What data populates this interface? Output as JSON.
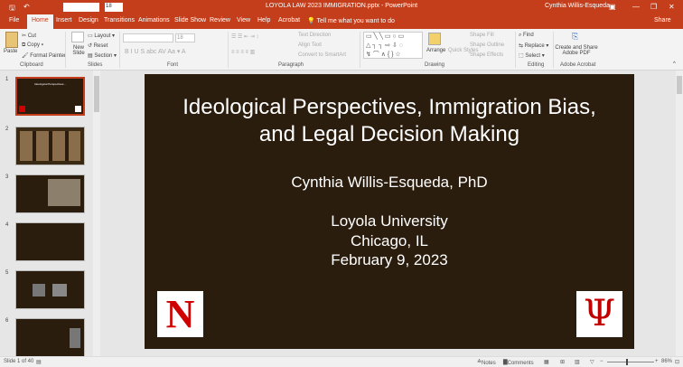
{
  "window": {
    "title": "LOYOLA LAW 2023 IMMIGRATION.pptx  -  PowerPoint",
    "user": "Cynthia Willis-Esqueda",
    "font_size": "18"
  },
  "tabs": [
    "File",
    "Home",
    "Insert",
    "Design",
    "Transitions",
    "Animations",
    "Slide Show",
    "Review",
    "View",
    "Help",
    "Acrobat"
  ],
  "tell_me": "Tell me what you want to do",
  "share": "Share",
  "ribbon": {
    "clipboard": {
      "paste": "Paste",
      "cut": "Cut",
      "copy": "Copy",
      "format_painter": "Format Painter",
      "label": "Clipboard"
    },
    "slides": {
      "new_slide": "New Slide",
      "layout": "Layout",
      "reset": "Reset",
      "section": "Section",
      "label": "Slides"
    },
    "font": {
      "size": "18",
      "label": "Font"
    },
    "paragraph": {
      "text_direction": "Text Direction",
      "align_text": "Align Text",
      "convert": "Convert to SmartArt",
      "label": "Paragraph"
    },
    "drawing": {
      "arrange": "Arrange",
      "quick_styles": "Quick Styles",
      "shape_fill": "Shape Fill",
      "shape_outline": "Shape Outline",
      "shape_effects": "Shape Effects",
      "label": "Drawing"
    },
    "editing": {
      "find": "Find",
      "replace": "Replace",
      "select": "Select",
      "label": "Editing"
    },
    "acrobat": {
      "create": "Create and Share Adobe PDF",
      "label": "Adobe Acrobat"
    }
  },
  "thumbnails": [
    1,
    2,
    3,
    4,
    5,
    6
  ],
  "slide": {
    "title": "Ideological Perspectives, Immigration Bias, and Legal Decision Making",
    "author": "Cynthia Willis-Esqueda, PhD",
    "line1": "Loyola University",
    "line2": "Chicago, IL",
    "line3": "February 9, 2023",
    "logo_left": "N",
    "logo_right": "Ψ"
  },
  "status": {
    "slide": "Slide 1 of 40",
    "notes": "Notes",
    "comments": "Comments",
    "zoom": "86%"
  },
  "colors": {
    "accent": "#c43e1c",
    "slide_bg": "#2b1d0e",
    "nebraska_red": "#d00000"
  }
}
